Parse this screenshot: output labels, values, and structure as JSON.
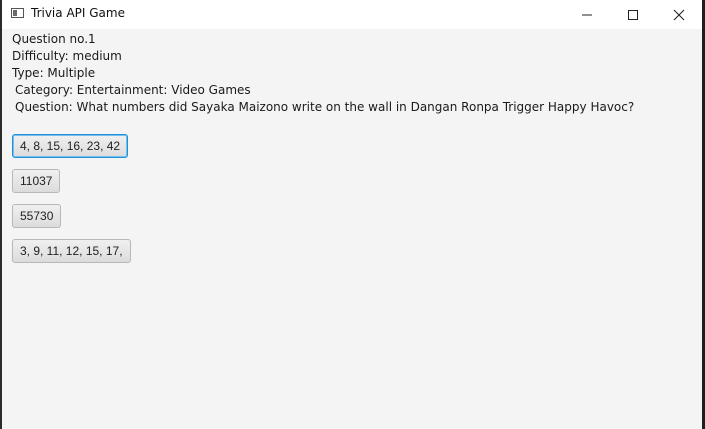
{
  "window": {
    "title": "Trivia API Game",
    "icon": "app-window-icon"
  },
  "question": {
    "number_line": "Question no.1",
    "difficulty_line": "Difficulty: medium",
    "type_line": "Type: Multiple",
    "category_line": "Category: Entertainment: Video Games",
    "question_line": "Question: What numbers did Sayaka Maizono write on the wall in Dangan Ronpa Trigger Happy Havoc?"
  },
  "answers": [
    {
      "label": "4, 8, 15, 16, 23, 42",
      "focused": true
    },
    {
      "label": "11037",
      "focused": false
    },
    {
      "label": "55730",
      "focused": false
    },
    {
      "label": "3, 9, 11, 12, 15, 17,",
      "focused": false
    }
  ],
  "colors": {
    "focus_border": "#1f8fd6",
    "window_bg": "#f4f4f4",
    "titlebar_bg": "#ffffff"
  }
}
